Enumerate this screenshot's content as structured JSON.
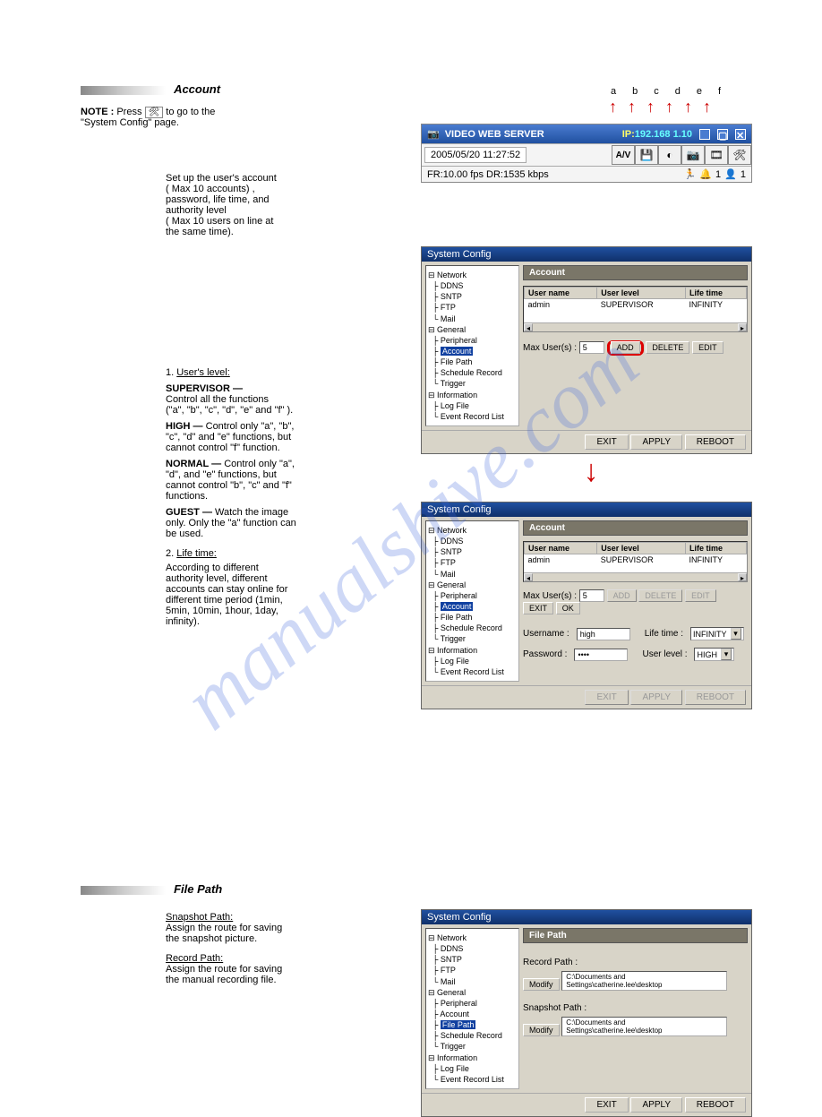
{
  "accountTitle": "Account",
  "left": {
    "barLabel": "Account",
    "noteOneA": "Press ",
    "noteOneB": " to go to the",
    "noteTwo": "\"System Config\" page.",
    "line1": "Set up the user's account",
    "line2": "( Max 10 accounts) ,",
    "line3": "password, life time, and",
    "line4": "authority level",
    "line5": "( Max 10 users on line at",
    "line6": "the same time).",
    "userLevel": "User's level:",
    "supervisor": "SUPERVISOR —",
    "supervisorDesc": "Control all the functions",
    "supervisorDesc2": "(\"a\", \"b\", \"c\", \"d\", \"e\" and \"f\" ).",
    "high": "HIGH —",
    "highDesc": "Control only \"a\", \"b\",",
    "highDesc2": "\"c\", \"d\" and \"e\" functions, but",
    "highDesc3": "cannot control \"f\" function.",
    "normal": "NORMAL —",
    "normalDesc": "Control only \"a\",",
    "normalDesc2": "\"d\", and \"e\" functions, but",
    "normalDesc3": "cannot control \"b\", \"c\" and \"f\"",
    "normalDesc4": "functions.",
    "guest": "GUEST —",
    "guestDesc": "Watch the image",
    "guestDesc2": "only. Only the \"a\" function can",
    "guestDesc3": "be used.",
    "lifeTime": "Life time:",
    "lifeTimeDesc": "According to different",
    "lifeTimeDesc2": "authority level, different",
    "lifeTimeDesc3": "accounts can stay online for",
    "lifeTimeDesc4": "different time period (1min,",
    "lifeTimeDesc5": "5min, 10min, 1hour, 1day,",
    "lifeTimeDesc6": "infinity).",
    "filePathBar": "File Path",
    "snapshotPath": "Snapshot Path:",
    "snapshotDesc": "Assign the route for saving",
    "snapshotDesc2": "the snapshot picture.",
    "recordPath": "Record Path:",
    "recordDesc": "Assign the route for saving",
    "recordDesc2": "the manual recording file."
  },
  "vws": {
    "title": "VIDEO WEB SERVER",
    "ipLabel": "IP:",
    "ip": "192.168 1.10",
    "time": "2005/05/20 11:27:52",
    "av": "A/V",
    "stats": "FR:10.00 fps DR:1535 kbps",
    "n1": "1",
    "n2": "1"
  },
  "tree": {
    "network": "Network",
    "ddns": "DDNS",
    "sntp": "SNTP",
    "ftp": "FTP",
    "mail": "Mail",
    "general": "General",
    "peripheral": "Peripheral",
    "account": "Account",
    "filepath": "File Path",
    "schedule": "Schedule Record",
    "trigger": "Trigger",
    "information": "Information",
    "logfile": "Log File",
    "eventrec": "Event Record List"
  },
  "sys": {
    "title": "System Config",
    "userTable": {
      "h1": "User name",
      "h2": "User level",
      "h3": "Life time",
      "r1c1": "admin",
      "r1c2": "SUPERVISOR",
      "r1c3": "INFINITY"
    },
    "maxuser": "Max User(s) :",
    "maxval": "5",
    "add": "ADD",
    "delete": "DELETE",
    "edit": "EDIT",
    "exit": "EXIT",
    "ok": "OK",
    "apply": "APPLY",
    "reboot": "REBOOT",
    "username": "Username :",
    "usernameVal": "high",
    "password": "Password :",
    "passwordVal": "****",
    "lifetime": "Life time :",
    "lifetimeVal": "INFINITY",
    "userlevel": "User level :",
    "userlevelVal": "HIGH"
  },
  "filepath": {
    "title": "File Path",
    "recordPath": "Record Path :",
    "snapshotPath": "Snapshot Path :",
    "modify": "Modify",
    "pathVal": "C:\\Documents and Settings\\catherine.lee\\desktop"
  },
  "labels": {
    "a": "a",
    "b": "b",
    "c": "c",
    "d": "d",
    "e": "e",
    "f": "f"
  }
}
